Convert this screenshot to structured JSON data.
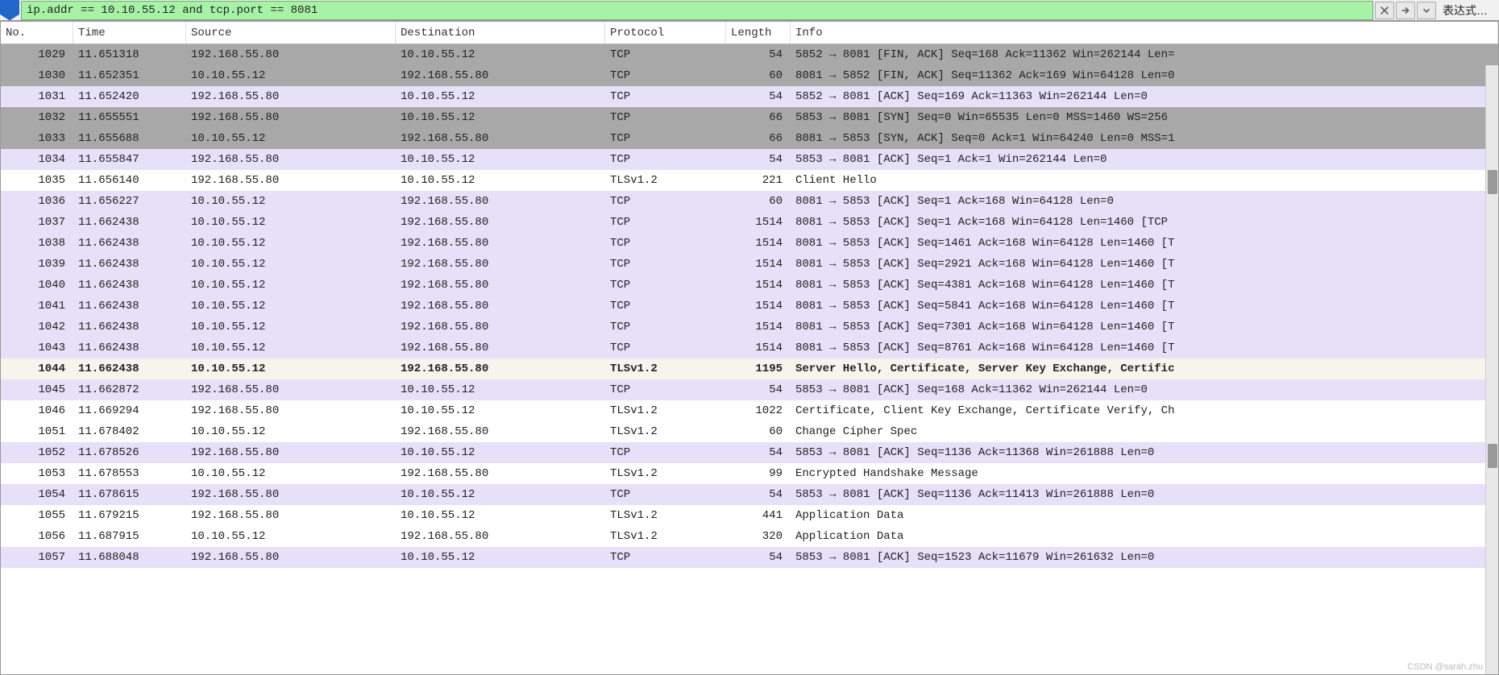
{
  "filter": {
    "value": "ip.addr == 10.10.55.12 and tcp.port == 8081",
    "expression_label": "表达式…"
  },
  "columns": {
    "no": "No.",
    "time": "Time",
    "source": "Source",
    "destination": "Destination",
    "protocol": "Protocol",
    "length": "Length",
    "info": "Info"
  },
  "rows": [
    {
      "no": "1029",
      "time": "11.651318",
      "src": "192.168.55.80",
      "dst": "10.10.55.12",
      "proto": "TCP",
      "len": "54",
      "info": "5852 → 8081 [FIN, ACK] Seq=168 Ack=11362 Win=262144 Len=",
      "bg": "gray"
    },
    {
      "no": "1030",
      "time": "11.652351",
      "src": "10.10.55.12",
      "dst": "192.168.55.80",
      "proto": "TCP",
      "len": "60",
      "info": "8081 → 5852 [FIN, ACK] Seq=11362 Ack=169 Win=64128 Len=0",
      "bg": "gray"
    },
    {
      "no": "1031",
      "time": "11.652420",
      "src": "192.168.55.80",
      "dst": "10.10.55.12",
      "proto": "TCP",
      "len": "54",
      "info": "5852 → 8081 [ACK] Seq=169 Ack=11363 Win=262144 Len=0",
      "bg": "lilac"
    },
    {
      "no": "1032",
      "time": "11.655551",
      "src": "192.168.55.80",
      "dst": "10.10.55.12",
      "proto": "TCP",
      "len": "66",
      "info": "5853 → 8081 [SYN] Seq=0 Win=65535 Len=0 MSS=1460 WS=256",
      "bg": "gray"
    },
    {
      "no": "1033",
      "time": "11.655688",
      "src": "10.10.55.12",
      "dst": "192.168.55.80",
      "proto": "TCP",
      "len": "66",
      "info": "8081 → 5853 [SYN, ACK] Seq=0 Ack=1 Win=64240 Len=0 MSS=1",
      "bg": "gray"
    },
    {
      "no": "1034",
      "time": "11.655847",
      "src": "192.168.55.80",
      "dst": "10.10.55.12",
      "proto": "TCP",
      "len": "54",
      "info": "5853 → 8081 [ACK] Seq=1 Ack=1 Win=262144 Len=0",
      "bg": "lilac"
    },
    {
      "no": "1035",
      "time": "11.656140",
      "src": "192.168.55.80",
      "dst": "10.10.55.12",
      "proto": "TLSv1.2",
      "len": "221",
      "info": "Client Hello",
      "bg": "white"
    },
    {
      "no": "1036",
      "time": "11.656227",
      "src": "10.10.55.12",
      "dst": "192.168.55.80",
      "proto": "TCP",
      "len": "60",
      "info": "8081 → 5853 [ACK] Seq=1 Ack=168 Win=64128 Len=0",
      "bg": "lilac"
    },
    {
      "no": "1037",
      "time": "11.662438",
      "src": "10.10.55.12",
      "dst": "192.168.55.80",
      "proto": "TCP",
      "len": "1514",
      "info": "8081 → 5853 [ACK] Seq=1 Ack=168 Win=64128 Len=1460 [TCP",
      "bg": "lilac"
    },
    {
      "no": "1038",
      "time": "11.662438",
      "src": "10.10.55.12",
      "dst": "192.168.55.80",
      "proto": "TCP",
      "len": "1514",
      "info": "8081 → 5853 [ACK] Seq=1461 Ack=168 Win=64128 Len=1460 [T",
      "bg": "lilac"
    },
    {
      "no": "1039",
      "time": "11.662438",
      "src": "10.10.55.12",
      "dst": "192.168.55.80",
      "proto": "TCP",
      "len": "1514",
      "info": "8081 → 5853 [ACK] Seq=2921 Ack=168 Win=64128 Len=1460 [T",
      "bg": "lilac"
    },
    {
      "no": "1040",
      "time": "11.662438",
      "src": "10.10.55.12",
      "dst": "192.168.55.80",
      "proto": "TCP",
      "len": "1514",
      "info": "8081 → 5853 [ACK] Seq=4381 Ack=168 Win=64128 Len=1460 [T",
      "bg": "lilac"
    },
    {
      "no": "1041",
      "time": "11.662438",
      "src": "10.10.55.12",
      "dst": "192.168.55.80",
      "proto": "TCP",
      "len": "1514",
      "info": "8081 → 5853 [ACK] Seq=5841 Ack=168 Win=64128 Len=1460 [T",
      "bg": "lilac"
    },
    {
      "no": "1042",
      "time": "11.662438",
      "src": "10.10.55.12",
      "dst": "192.168.55.80",
      "proto": "TCP",
      "len": "1514",
      "info": "8081 → 5853 [ACK] Seq=7301 Ack=168 Win=64128 Len=1460 [T",
      "bg": "lilac"
    },
    {
      "no": "1043",
      "time": "11.662438",
      "src": "10.10.55.12",
      "dst": "192.168.55.80",
      "proto": "TCP",
      "len": "1514",
      "info": "8081 → 5853 [ACK] Seq=8761 Ack=168 Win=64128 Len=1460 [T",
      "bg": "lilac"
    },
    {
      "no": "1044",
      "time": "11.662438",
      "src": "10.10.55.12",
      "dst": "192.168.55.80",
      "proto": "TLSv1.2",
      "len": "1195",
      "info": "Server Hello, Certificate, Server Key Exchange, Certific",
      "bg": "cream"
    },
    {
      "no": "1045",
      "time": "11.662872",
      "src": "192.168.55.80",
      "dst": "10.10.55.12",
      "proto": "TCP",
      "len": "54",
      "info": "5853 → 8081 [ACK] Seq=168 Ack=11362 Win=262144 Len=0",
      "bg": "lilac"
    },
    {
      "no": "1046",
      "time": "11.669294",
      "src": "192.168.55.80",
      "dst": "10.10.55.12",
      "proto": "TLSv1.2",
      "len": "1022",
      "info": "Certificate, Client Key Exchange, Certificate Verify, Ch",
      "bg": "white"
    },
    {
      "no": "1051",
      "time": "11.678402",
      "src": "10.10.55.12",
      "dst": "192.168.55.80",
      "proto": "TLSv1.2",
      "len": "60",
      "info": "Change Cipher Spec",
      "bg": "white"
    },
    {
      "no": "1052",
      "time": "11.678526",
      "src": "192.168.55.80",
      "dst": "10.10.55.12",
      "proto": "TCP",
      "len": "54",
      "info": "5853 → 8081 [ACK] Seq=1136 Ack=11368 Win=261888 Len=0",
      "bg": "lilac"
    },
    {
      "no": "1053",
      "time": "11.678553",
      "src": "10.10.55.12",
      "dst": "192.168.55.80",
      "proto": "TLSv1.2",
      "len": "99",
      "info": "Encrypted Handshake Message",
      "bg": "white"
    },
    {
      "no": "1054",
      "time": "11.678615",
      "src": "192.168.55.80",
      "dst": "10.10.55.12",
      "proto": "TCP",
      "len": "54",
      "info": "5853 → 8081 [ACK] Seq=1136 Ack=11413 Win=261888 Len=0",
      "bg": "lilac"
    },
    {
      "no": "1055",
      "time": "11.679215",
      "src": "192.168.55.80",
      "dst": "10.10.55.12",
      "proto": "TLSv1.2",
      "len": "441",
      "info": "Application Data",
      "bg": "white"
    },
    {
      "no": "1056",
      "time": "11.687915",
      "src": "10.10.55.12",
      "dst": "192.168.55.80",
      "proto": "TLSv1.2",
      "len": "320",
      "info": "Application Data",
      "bg": "white"
    },
    {
      "no": "1057",
      "time": "11.688048",
      "src": "192.168.55.80",
      "dst": "10.10.55.12",
      "proto": "TCP",
      "len": "54",
      "info": "5853 → 8081 [ACK] Seq=1523 Ack=11679 Win=261632 Len=0",
      "bg": "lilac"
    }
  ],
  "watermark": "CSDN @sarah.zhu"
}
